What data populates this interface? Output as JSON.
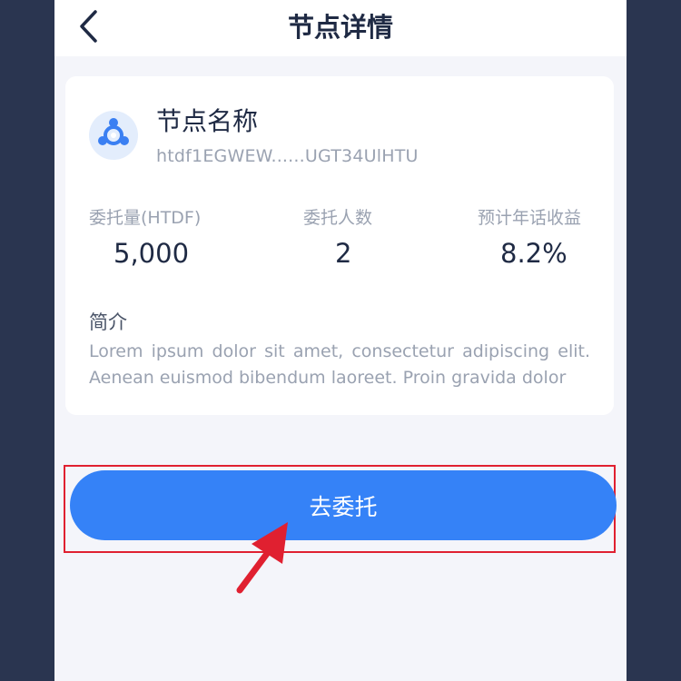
{
  "navbar": {
    "title": "节点详情",
    "back_icon": "chevron-left-icon"
  },
  "node": {
    "logo_icon": "node-network-icon",
    "name": "节点名称",
    "address": "htdf1EGWEW......UGT34UlHTU"
  },
  "stats": [
    {
      "label": "委托量(HTDF)",
      "value": "5,000"
    },
    {
      "label": "委托人数",
      "value": "2"
    },
    {
      "label": "预计年话收益",
      "value": "8.2%"
    }
  ],
  "intro": {
    "title": "简介",
    "text": "Lorem ipsum dolor sit amet, consectetur adipiscing elit. Aenean euismod bibendum laoreet. Proin gravida dolor"
  },
  "action": {
    "delegate_label": "去委托"
  },
  "colors": {
    "accent": "#3582f7",
    "highlight": "#e02030",
    "page_background": "#2a3550"
  }
}
